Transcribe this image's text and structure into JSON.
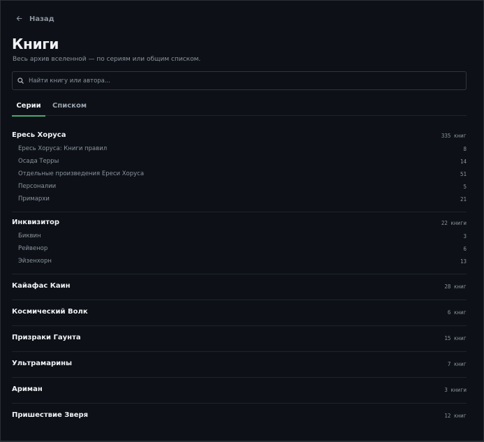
{
  "nav": {
    "back_label": "Назад"
  },
  "page": {
    "title": "Книги",
    "subtitle": "Весь архив вселенной — по сериям или общим списком."
  },
  "search": {
    "placeholder": "Найти книгу или автора...",
    "value": ""
  },
  "tabs": [
    {
      "label": "Серии",
      "active": true
    },
    {
      "label": "Списком",
      "active": false
    }
  ],
  "series": [
    {
      "name": "Ересь Хоруса",
      "count": "335 книг",
      "subseries": [
        {
          "name": "Ересь Хоруса: Книги правил",
          "count": "8"
        },
        {
          "name": "Осада Терры",
          "count": "14"
        },
        {
          "name": "Отдельные произведения Ереси Хоруса",
          "count": "51"
        },
        {
          "name": "Персоналии",
          "count": "5"
        },
        {
          "name": "Примархи",
          "count": "21"
        }
      ]
    },
    {
      "name": "Инквизитор",
      "count": "22 книги",
      "subseries": [
        {
          "name": "Биквин",
          "count": "3"
        },
        {
          "name": "Рейвенор",
          "count": "6"
        },
        {
          "name": "Эйзенхорн",
          "count": "13"
        }
      ]
    },
    {
      "name": "Кайафас Каин",
      "count": "28 книг",
      "subseries": []
    },
    {
      "name": "Космический Волк",
      "count": "6 книг",
      "subseries": []
    },
    {
      "name": "Призраки Гаунта",
      "count": "15 книг",
      "subseries": []
    },
    {
      "name": "Ультрамарины",
      "count": "7 книг",
      "subseries": []
    },
    {
      "name": "Ариман",
      "count": "3 книги",
      "subseries": []
    },
    {
      "name": "Пришествие Зверя",
      "count": "12 книг",
      "subseries": []
    }
  ],
  "icons": {
    "back": "arrow-left-icon",
    "search": "search-icon"
  },
  "colors": {
    "background": "#0d1117",
    "accent": "#4ca873",
    "muted": "#8b949e"
  }
}
